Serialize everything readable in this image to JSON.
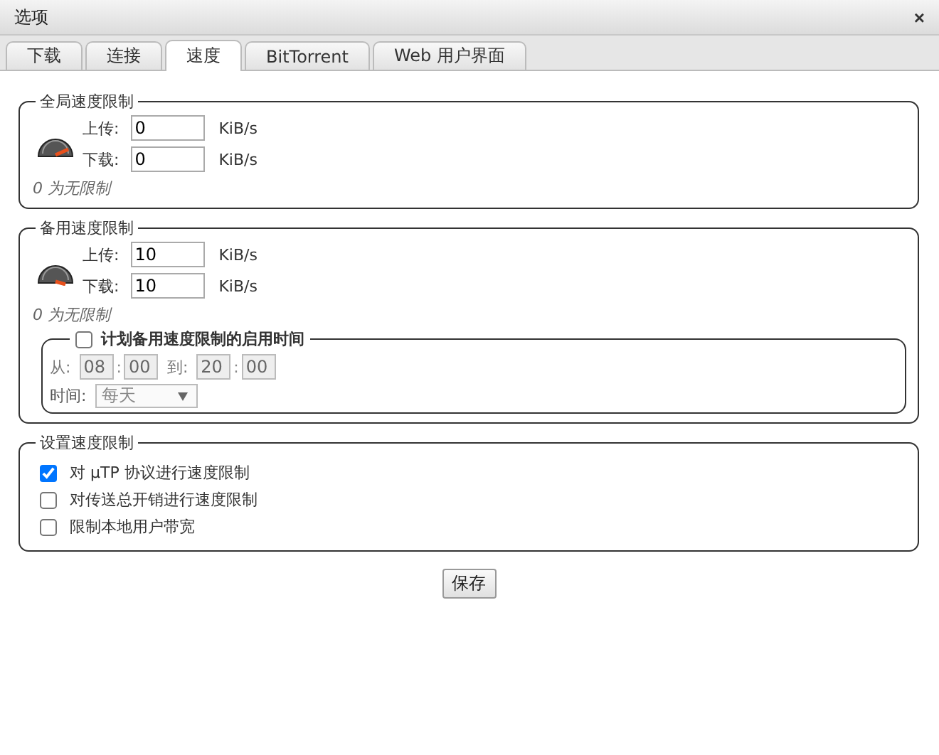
{
  "window": {
    "title": "选项",
    "close": "×"
  },
  "tabs": [
    {
      "label": "下载",
      "selected": false
    },
    {
      "label": "连接",
      "selected": false
    },
    {
      "label": "速度",
      "selected": true
    },
    {
      "label": "BitTorrent",
      "selected": false
    },
    {
      "label": "Web 用户界面",
      "selected": false
    }
  ],
  "global_limits": {
    "legend": "全局速度限制",
    "upload_label": "上传:",
    "upload": "0",
    "download_label": "下载:",
    "download": "0",
    "unit_up": "KiB/s",
    "unit_down": "KiB/s",
    "hint": "0 为无限制"
  },
  "alt_limits": {
    "legend": "备用速度限制",
    "upload_label": "上传:",
    "upload": "10",
    "download_label": "下载:",
    "download": "10",
    "unit_up": "KiB/s",
    "unit_down": "KiB/s",
    "hint": "0 为无限制"
  },
  "schedule": {
    "legend": "计划备用速度限制的启用时间",
    "checked": false,
    "from_label": "从:",
    "from_hour": "08",
    "from_separator": ":",
    "from_minute": "00",
    "to_label": "到:",
    "to_hour": "20",
    "to_separator": ":",
    "to_minute": "00",
    "days_label": "时间:",
    "days": "每天",
    "disabled": true
  },
  "settings": {
    "legend": "设置速度限制",
    "options": [
      {
        "label": "对 µTP 协议进行速度限制",
        "checked": true
      },
      {
        "label": "对传送总开销进行速度限制",
        "checked": false
      },
      {
        "label": "限制本地用户带宽",
        "checked": false
      }
    ]
  },
  "save_button": "保存"
}
